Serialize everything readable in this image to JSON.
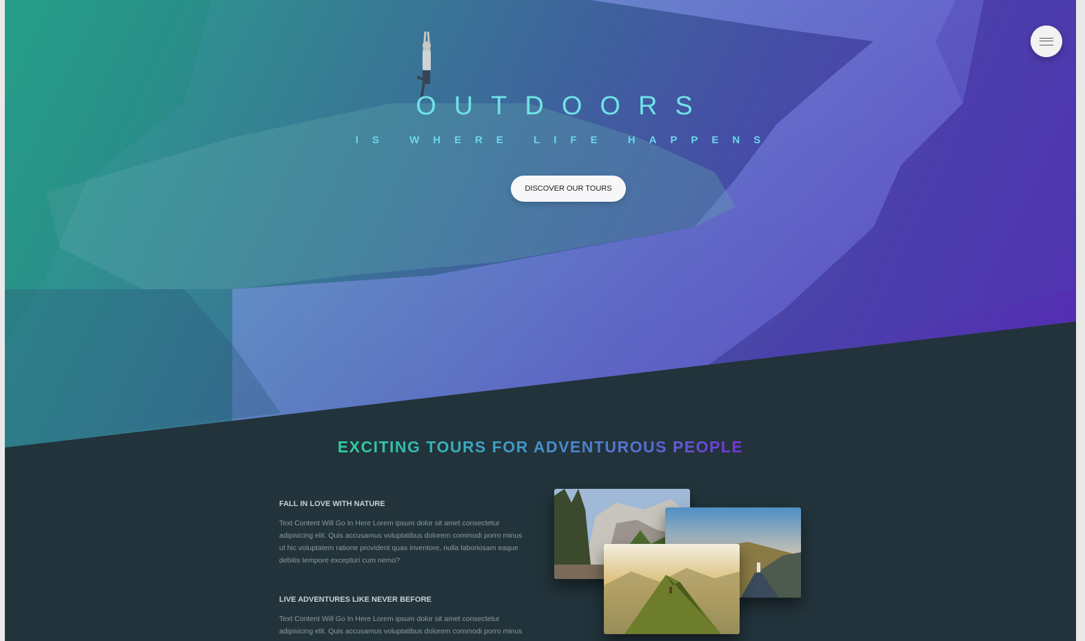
{
  "hero": {
    "title": "OUTDOORS",
    "subtitle": "IS WHERE LIFE HAPPENS",
    "cta_label": "DISCOVER OUR TOURS",
    "gradient": [
      "#28b496",
      "#5a28be"
    ]
  },
  "menu": {
    "icon": "hamburger-menu-icon"
  },
  "tours": {
    "heading": "EXCITING TOURS FOR ADVENTUROUS PEOPLE",
    "features": [
      {
        "title": "FALL IN LOVE WITH NATURE",
        "text": "Text Content Will Go In Here Lorem ipsum dolor sit amet consectetur adipisicing elit. Quis accusamus voluptatibus dolorem commodi porro minus ut hic voluptatem ratione provident quas inventore, nulla laboriosam eaque debitis tempore excepturi cum nemo?"
      },
      {
        "title": "LIVE ADVENTURES LIKE NEVER BEFORE",
        "text": "Text Content Will Go In Here Lorem ipsum dolor sit amet consectetur adipisicing elit. Quis accusamus voluptatibus dolorem commodi porro minus"
      }
    ],
    "photos": [
      "forest-cliffs-photo",
      "hiker-road-sunset-photo",
      "mountain-ridge-sunrise-photo"
    ]
  },
  "colors": {
    "section_bg": "#22333b",
    "heading_start": "#2fcf9f",
    "heading_end": "#7437d9",
    "button_bg": "#f7f7fa"
  }
}
